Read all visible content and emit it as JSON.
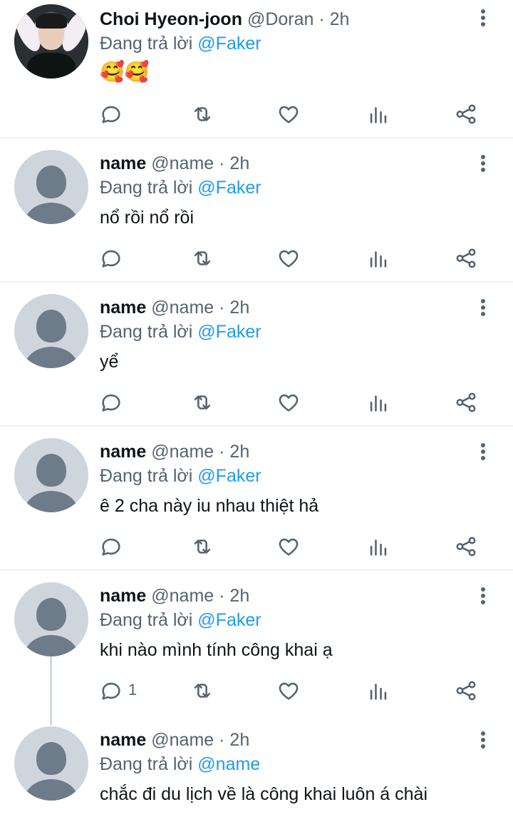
{
  "colors": {
    "accent": "#1d9bf0",
    "muted": "#536471",
    "text": "#0f1419"
  },
  "tweets": [
    {
      "name": "Choi Hyeon-joon",
      "handle": "@Doran",
      "time": "2h",
      "replying_prefix": "Đang trả lời",
      "replying_to": "@Faker",
      "text": "🥰🥰",
      "reply_count": ""
    },
    {
      "name": "name",
      "handle": "@name",
      "time": "2h",
      "replying_prefix": "Đang trả lời",
      "replying_to": "@Faker",
      "text": "nổ rồi nổ rồi",
      "reply_count": ""
    },
    {
      "name": "name",
      "handle": "@name",
      "time": "2h",
      "replying_prefix": "Đang trả lời",
      "replying_to": "@Faker",
      "text": "yể",
      "reply_count": ""
    },
    {
      "name": "name",
      "handle": "@name",
      "time": "2h",
      "replying_prefix": "Đang trả lời",
      "replying_to": "@Faker",
      "text": "ê 2 cha này iu nhau thiệt hả",
      "reply_count": ""
    },
    {
      "name": "name",
      "handle": "@name",
      "time": "2h",
      "replying_prefix": "Đang trả lời",
      "replying_to": "@Faker",
      "text": "khi nào mình tính công khai ạ",
      "reply_count": "1"
    },
    {
      "name": "name",
      "handle": "@name",
      "time": "2h",
      "replying_prefix": "Đang trả lời",
      "replying_to": "@name",
      "text": "chắc đi du lịch về là công khai luôn á chài",
      "reply_count": ""
    }
  ],
  "icons": {
    "reply": "reply-icon",
    "retweet": "retweet-icon",
    "like": "heart-icon",
    "views": "analytics-icon",
    "share": "share-icon",
    "more": "more-icon"
  }
}
